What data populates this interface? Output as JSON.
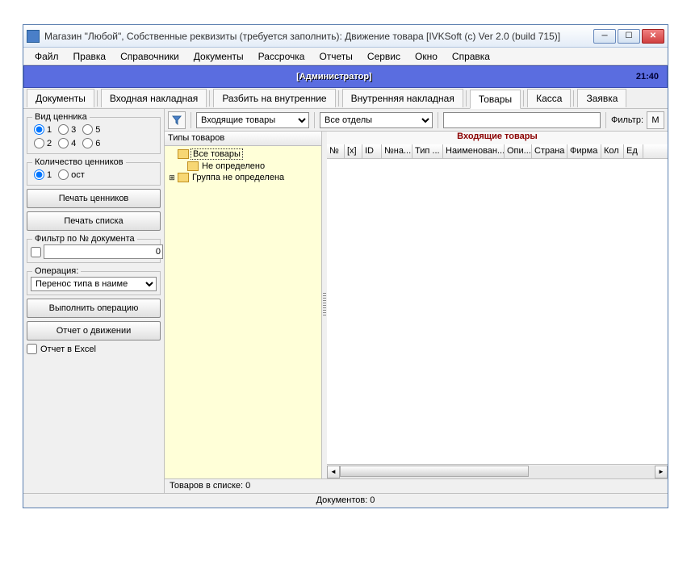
{
  "window": {
    "title": "Магазин \"Любой\", Собственные реквизиты (требуется заполнить): Движение товара [IVKSoft (c)  Ver 2.0 (build 715)]"
  },
  "menu": [
    "Файл",
    "Правка",
    "Справочники",
    "Документы",
    "Рассрочка",
    "Отчеты",
    "Сервис",
    "Окно",
    "Справка"
  ],
  "banner": {
    "admin": "[Администратор]",
    "time": "21:40"
  },
  "tabs": {
    "items": [
      "Документы",
      "Входная накладная",
      "Разбить на внутренние",
      "Внутренняя накладная",
      "Товары",
      "Касса",
      "Заявка"
    ],
    "active": 4
  },
  "left": {
    "priceTagGroup": "Вид ценника",
    "priceTagOptions": [
      "1",
      "3",
      "5",
      "2",
      "4",
      "6"
    ],
    "priceTagSelected": "1",
    "qtyGroup": "Количество ценников",
    "qtyOptions": [
      "1",
      "ост"
    ],
    "qtySelected": "1",
    "printTags": "Печать ценников",
    "printList": "Печать списка",
    "filterByDoc": "Фильтр по № документа",
    "filterValue": "0",
    "operationLabel": "Операция:",
    "operationCombo": "Перенос типа в наиме",
    "executeOp": "Выполнить операцию",
    "movementReport": "Отчет о движении",
    "excelReport": "Отчет в Excel"
  },
  "toolbar": {
    "combo1": "Входящие товары",
    "combo2": "Все отделы",
    "searchValue": "",
    "filterLabel": "Фильтр:",
    "letterM": "М"
  },
  "tree": {
    "header": "Типы товаров",
    "items": [
      {
        "label": "Все товары",
        "selected": true,
        "expandable": false,
        "level": 0
      },
      {
        "label": "Не определено",
        "selected": false,
        "expandable": false,
        "level": 1
      },
      {
        "label": "Группа не определена",
        "selected": false,
        "expandable": true,
        "level": 0
      }
    ]
  },
  "grid": {
    "title": "Входящие товары",
    "columns": [
      "№",
      "[x]",
      "ID",
      "№на...",
      "Тип ...",
      "Наименован...",
      "Опи...",
      "Страна",
      "Фирма",
      "Кол",
      "Ед"
    ]
  },
  "status": {
    "goods": "Товаров в списке: 0",
    "docs": "Документов: 0"
  }
}
